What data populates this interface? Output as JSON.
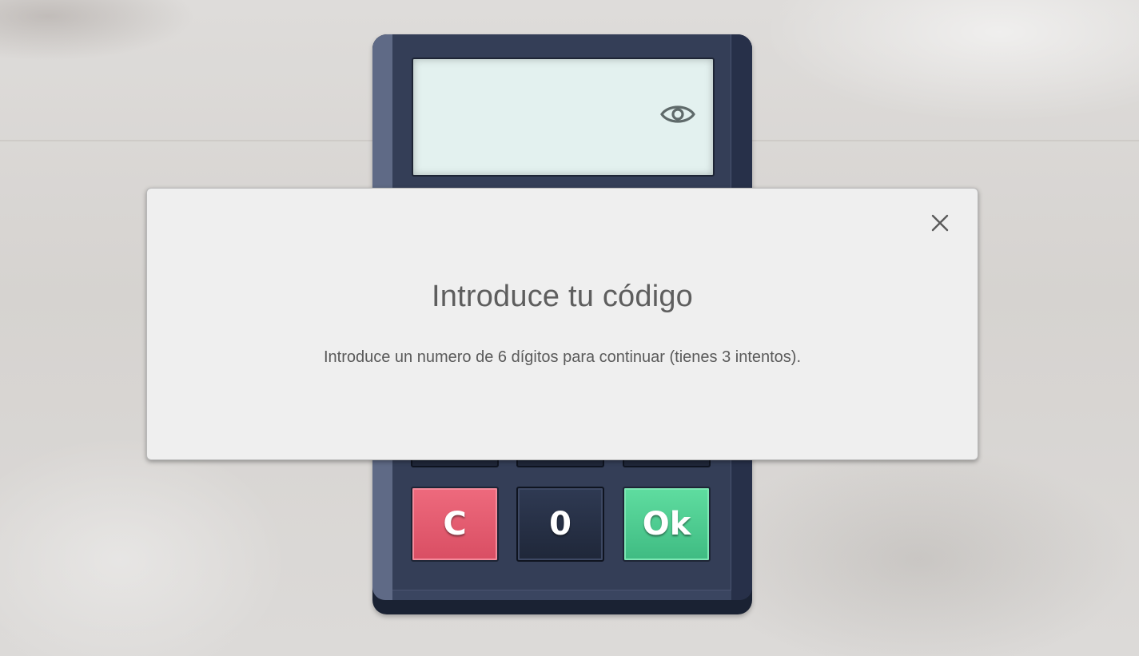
{
  "calculator": {
    "display_value": "",
    "visibility_icon": "eye-icon",
    "keys": {
      "clear": "C",
      "zero": "0",
      "ok": "Ok"
    },
    "colors": {
      "clear": "#e05a6e",
      "ok": "#4fcb8f",
      "body": "#343e57",
      "display": "#e3f1ef"
    }
  },
  "modal": {
    "title": "Introduce tu código",
    "message": "Introduce un numero de 6 dígitos para continuar (tienes 3 intentos).",
    "close_icon": "close-icon"
  }
}
